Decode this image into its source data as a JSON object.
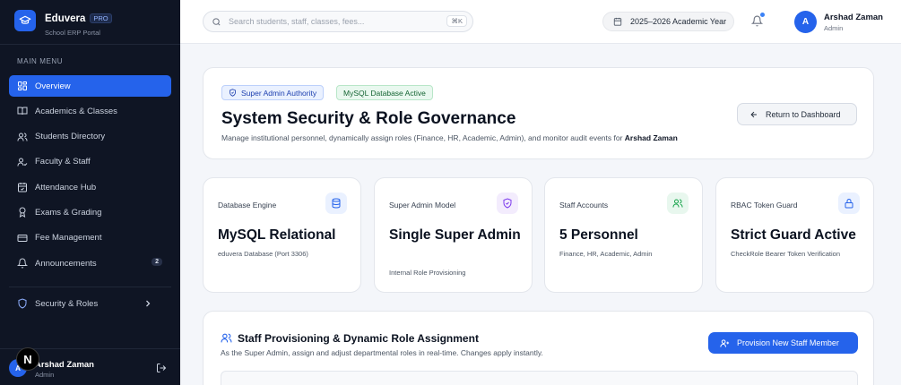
{
  "brand": {
    "name": "Eduvera",
    "pro": "PRO",
    "subtitle": "School ERP Portal"
  },
  "sidebar": {
    "menu_title": "MAIN MENU",
    "items": [
      {
        "label": "Overview",
        "icon": "grid-icon",
        "active": true
      },
      {
        "label": "Academics & Classes",
        "icon": "book-icon"
      },
      {
        "label": "Students Directory",
        "icon": "users-icon"
      },
      {
        "label": "Faculty & Staff",
        "icon": "user-check-icon"
      },
      {
        "label": "Attendance Hub",
        "icon": "calendar-check-icon"
      },
      {
        "label": "Exams & Grading",
        "icon": "award-icon"
      },
      {
        "label": "Fee Management",
        "icon": "credit-card-icon"
      },
      {
        "label": "Announcements",
        "icon": "bell-icon",
        "badge": "2"
      }
    ],
    "security": {
      "label": "Security & Roles"
    },
    "user": {
      "initial": "A",
      "name": "Arshad Zaman",
      "role": "Admin"
    },
    "n_badge": "N"
  },
  "topbar": {
    "search_placeholder": "Search students, staff, classes, fees...",
    "shortcut": "⌘K",
    "academic_year": "2025–2026 Academic Year",
    "user": {
      "initial": "A",
      "name": "Arshad Zaman",
      "role": "Admin"
    }
  },
  "header": {
    "tag_authority": "Super Admin Authority",
    "tag_db": "MySQL Database Active",
    "title": "System Security & Role Governance",
    "subtitle_prefix": "Manage institutional personnel, dynamically assign roles (Finance, HR, Academic, Admin), and monitor audit events for",
    "subtitle_user": "Arshad Zaman",
    "return_label": "Return to Dashboard"
  },
  "stats": [
    {
      "label": "Database Engine",
      "value": "MySQL Relational",
      "sub": "eduvera Database (Port 3306)",
      "icon": "database-icon"
    },
    {
      "label": "Super Admin Model",
      "value": "Single Super Admin",
      "sub": "Internal Role Provisioning",
      "icon": "shield-icon"
    },
    {
      "label": "Staff Accounts",
      "value": "5 Personnel",
      "sub": "Finance, HR, Academic, Admin",
      "icon": "users-icon"
    },
    {
      "label": "RBAC Token Guard",
      "value": "Strict Guard Active",
      "sub": "CheckRole Bearer Token Verification",
      "icon": "lock-icon"
    }
  ],
  "provision": {
    "title": "Staff Provisioning & Dynamic Role Assignment",
    "subtitle": "As the Super Admin, assign and adjust departmental roles in real-time. Changes apply instantly.",
    "button": "Provision New Staff Member"
  },
  "colors": {
    "accent": "#2563eb",
    "sidebar_bg": "#0f1524",
    "page_bg": "#f4f6fa"
  }
}
